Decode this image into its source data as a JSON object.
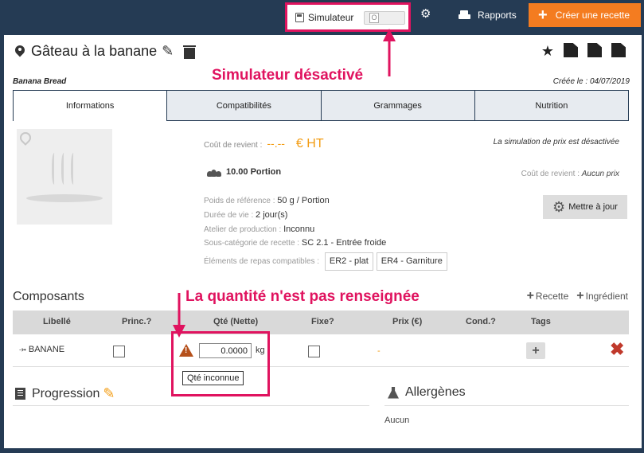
{
  "topbar": {
    "simulateur_label": "Simulateur",
    "toggle_state": "O",
    "rapports_label": "Rapports",
    "creer_label": "Créer une recette"
  },
  "recipe": {
    "title": "Gâteau à la banane",
    "subtitle": "Banana Bread",
    "created_label": "Créée le :",
    "created_date": "04/07/2019"
  },
  "annotations": {
    "simulator_off": "Simulateur désactivé",
    "qty_missing": "La quantité n'est pas renseignée"
  },
  "tabs": [
    {
      "label": "Informations"
    },
    {
      "label": "Compatibilités"
    },
    {
      "label": "Grammages"
    },
    {
      "label": "Nutrition"
    }
  ],
  "info": {
    "cout_label": "Coût de revient :",
    "cout_value": "--.--",
    "cout_unit": "€ HT",
    "simulation_note": "La simulation de prix est désactivée",
    "portion": "10.00 Portion",
    "cout2_label": "Coût de revient :",
    "cout2_value": "Aucun prix",
    "poids_label": "Poids de référence :",
    "poids_value": "50 g / Portion",
    "duree_label": "Durée de vie :",
    "duree_value": "2 jour(s)",
    "atelier_label": "Atelier de production :",
    "atelier_value": "Inconnu",
    "souscat_label": "Sous-catégorie de recette :",
    "souscat_value": "SC 2.1 - Entrée froide",
    "elements_label": "Éléments de repas compatibles :",
    "elements": [
      "ER2 - plat",
      "ER4 - Garniture"
    ],
    "maj_label": "Mettre à jour"
  },
  "composants": {
    "title": "Composants",
    "add_recette": "Recette",
    "add_ingredient": "Ingrédient",
    "columns": [
      "Libellé",
      "Princ.?",
      "Qté (Nette)",
      "Fixe?",
      "Prix (€)",
      "Cond.?",
      "Tags"
    ],
    "rows": [
      {
        "name": "BANANE",
        "qty": "0.0000",
        "unit": "kg",
        "price": "-"
      }
    ],
    "tooltip": "Qté inconnue"
  },
  "sections": {
    "progression": "Progression",
    "allergenes": "Allergènes",
    "allergenes_value": "Aucun"
  },
  "colors": {
    "navy": "#253b54",
    "orange": "#f47c20",
    "annotation": "#e0135f",
    "delete": "#c0392b"
  }
}
